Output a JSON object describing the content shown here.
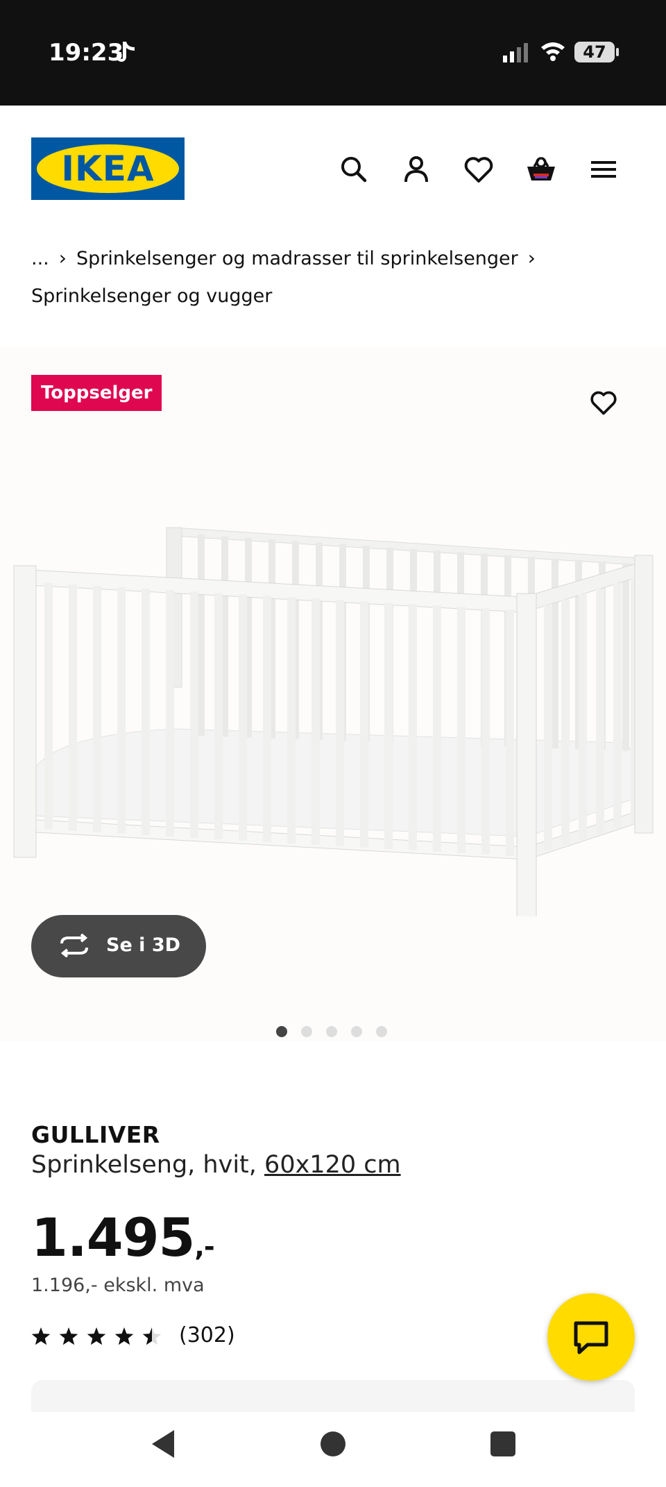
{
  "status_bar": {
    "time": "19:23",
    "battery": "47",
    "icons": [
      "tiktok-icon",
      "signal-icon",
      "wifi-icon",
      "battery-icon"
    ]
  },
  "header": {
    "logo_text": "IKEA",
    "icons": [
      "search-icon",
      "account-icon",
      "heart-icon",
      "basket-icon",
      "menu-icon"
    ]
  },
  "breadcrumb": {
    "ellipsis": "...",
    "level1": "Sprinkelsenger og madrasser til sprinkelsenger",
    "level2": "Sprinkelsenger og vugger"
  },
  "gallery": {
    "badge": "Toppselger",
    "view_3d_label": "Se i 3D",
    "image_count": 5,
    "active_index": 0
  },
  "product": {
    "name": "GULLIVER",
    "description": "Sprinkelseng, hvit,",
    "size_link": "60x120 cm",
    "price_main": "1.495",
    "price_suffix": ",-",
    "price_ex_vat": "1.196,- ekskl. mva",
    "rating": 4.5,
    "rating_max": 5,
    "review_count": "(302)"
  },
  "colors": {
    "ikea_blue": "#0058a3",
    "ikea_yellow": "#ffdb00",
    "badge": "#e00751",
    "button_dark": "#484848"
  }
}
